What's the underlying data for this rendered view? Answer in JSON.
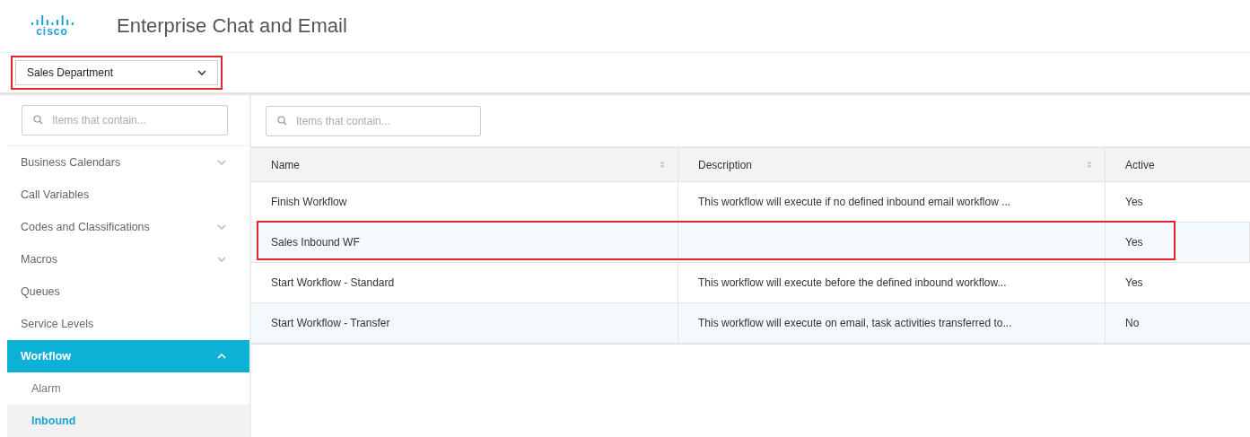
{
  "header": {
    "logo_text": "cisco",
    "title": "Enterprise Chat and Email"
  },
  "department_select": {
    "value": "Sales Department",
    "annotated": true
  },
  "sidebar": {
    "search": {
      "placeholder": "Items that contain..."
    },
    "items": [
      {
        "label": "Business Calendars",
        "kind": "group",
        "expanded": false,
        "selected": false
      },
      {
        "label": "Call Variables",
        "kind": "leaf",
        "selected": false
      },
      {
        "label": "Codes and Classifications",
        "kind": "group",
        "expanded": false,
        "selected": false
      },
      {
        "label": "Macros",
        "kind": "group",
        "expanded": false,
        "selected": false
      },
      {
        "label": "Queues",
        "kind": "leaf",
        "selected": false
      },
      {
        "label": "Service Levels",
        "kind": "leaf",
        "selected": false
      },
      {
        "label": "Workflow",
        "kind": "group",
        "expanded": true,
        "selected": true,
        "children": [
          {
            "label": "Alarm",
            "selected": false
          },
          {
            "label": "Inbound",
            "selected": true
          }
        ]
      }
    ]
  },
  "content": {
    "search": {
      "placeholder": "Items that contain..."
    },
    "table": {
      "columns": [
        {
          "label": "Name",
          "sortable": true
        },
        {
          "label": "Description",
          "sortable": true
        },
        {
          "label": "Active",
          "sortable": false
        }
      ],
      "rows": [
        {
          "cells": [
            "Finish Workflow",
            "This workflow will execute if no defined inbound email workflow ...",
            "Yes"
          ],
          "annotated": false
        },
        {
          "cells": [
            "Sales Inbound WF",
            "",
            "Yes"
          ],
          "annotated": true
        },
        {
          "cells": [
            "Start Workflow - Standard",
            "This workflow will execute before the defined inbound workflow...",
            "Yes"
          ],
          "annotated": false
        },
        {
          "cells": [
            "Start Workflow - Transfer",
            "This workflow will execute on email, task activities transferred to...",
            "No"
          ],
          "annotated": false
        }
      ]
    }
  }
}
